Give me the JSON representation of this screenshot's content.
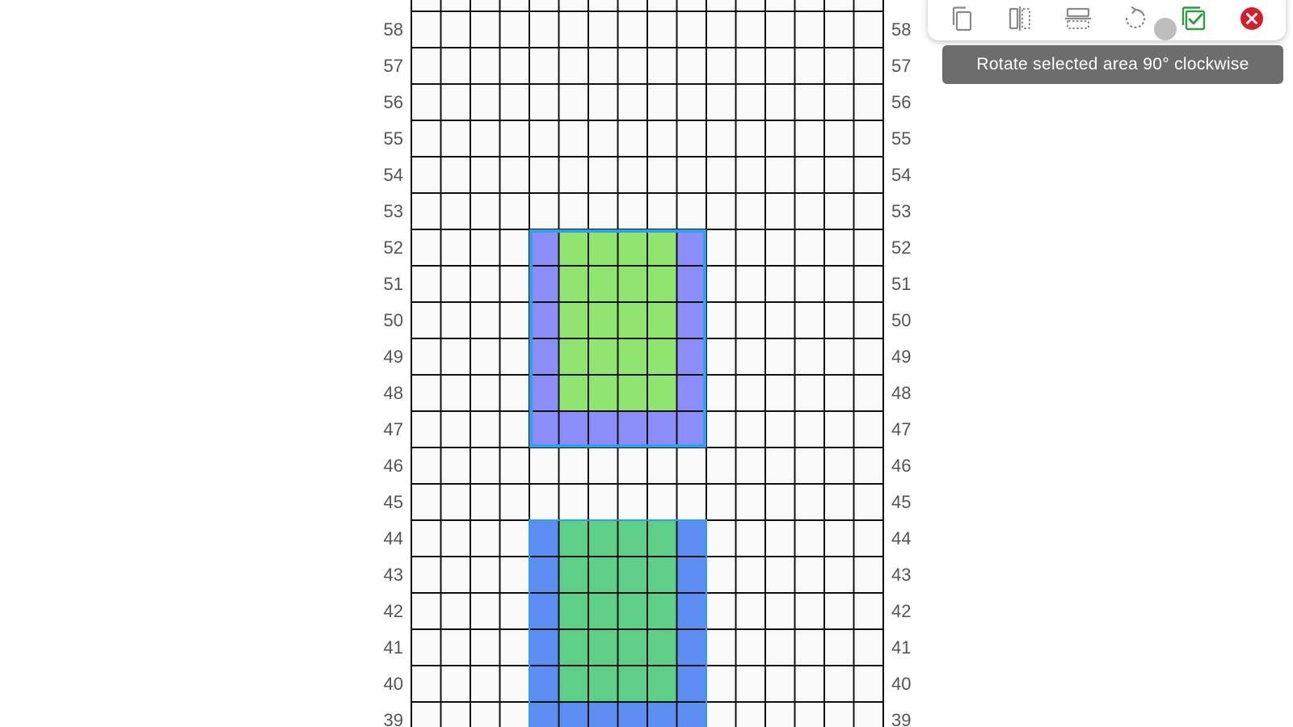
{
  "grid": {
    "rows": [
      58,
      57,
      56,
      55,
      54,
      53,
      52,
      51,
      50,
      49,
      48,
      47,
      46,
      45,
      44,
      43,
      42,
      41,
      40,
      39
    ],
    "columns": 16,
    "colors": {
      "empty": "#fafafa",
      "gridline": "#111111",
      "selection_border": "#2aa3ee",
      "upper_motif_border_cells": "#8d8dfa",
      "upper_motif_center_cells": "#8fe56f",
      "lower_motif_border_cells": "#5b8ef0",
      "lower_motif_center_cells": "#5ecf88"
    }
  },
  "toolbar": {
    "buttons": [
      {
        "name": "copy-button",
        "icon": "copy-icon"
      },
      {
        "name": "flip-horizontal-button",
        "icon": "flip-horizontal-icon"
      },
      {
        "name": "flip-vertical-button",
        "icon": "flip-vertical-icon"
      },
      {
        "name": "rotate-clockwise-button",
        "icon": "rotate-clockwise-icon"
      },
      {
        "name": "apply-selection-button",
        "icon": "checkbox-check-icon",
        "color": "#2e9e3c"
      },
      {
        "name": "close-selection-button",
        "icon": "close-icon",
        "color": "#d31e2b"
      }
    ]
  },
  "tooltip": {
    "text": "Rotate selected area 90° clockwise"
  }
}
